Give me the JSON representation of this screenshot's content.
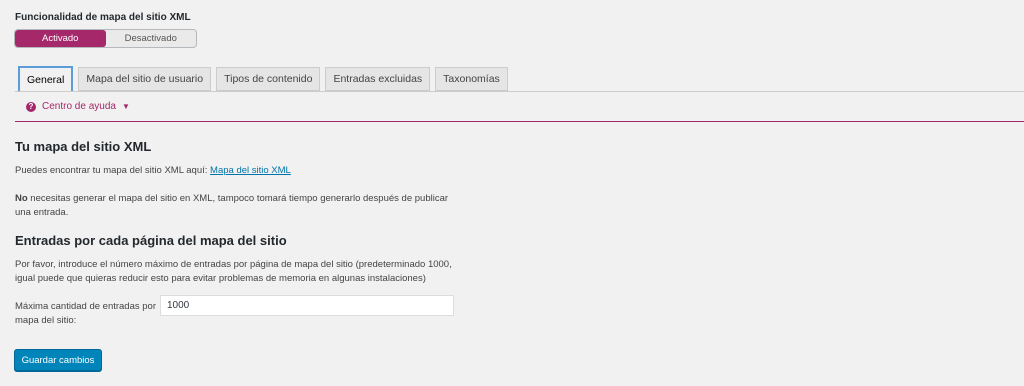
{
  "feature": {
    "label": "Funcionalidad de mapa del sitio XML",
    "on_label": "Activado",
    "off_label": "Desactivado"
  },
  "tabs": [
    {
      "label": "General",
      "active": true
    },
    {
      "label": "Mapa del sitio de usuario",
      "active": false
    },
    {
      "label": "Tipos de contenido",
      "active": false
    },
    {
      "label": "Entradas excluidas",
      "active": false
    },
    {
      "label": "Taxonomías",
      "active": false
    }
  ],
  "help": {
    "icon": "question-circle-icon",
    "label": "Centro de ayuda",
    "caret": "▼"
  },
  "sitemap_section": {
    "heading": "Tu mapa del sitio XML",
    "find_text": "Puedes encontrar tu mapa del sitio XML aquí: ",
    "link_text": "Mapa del sitio XML",
    "note_bold": "No",
    "note_rest": " necesitas generar el mapa del sitio en XML, tampoco tomará tiempo generarlo después de publicar",
    "note_rest2": "una entrada."
  },
  "entries_section": {
    "heading": "Entradas por cada página del mapa del sitio",
    "desc_line1": "Por favor, introduce el número máximo de entradas por página de mapa del sitio (predeterminado 1000,",
    "desc_line2": "igual puede que quieras reducir esto para evitar problemas de memoria en algunas instalaciones)",
    "field_label": "Máxima cantidad de entradas por mapa del sitio:",
    "field_value": "1000"
  },
  "save_label": "Guardar cambios",
  "colors": {
    "accent": "#a4286a",
    "primary_button": "#0085ba",
    "link": "#0073aa"
  }
}
